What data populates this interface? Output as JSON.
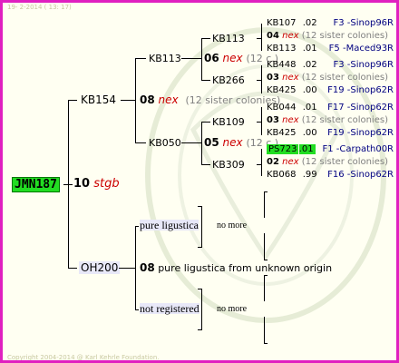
{
  "header": {
    "date": "19- 2-2014 ( 13: 17)"
  },
  "footer": {
    "copyright": "Copyright 2004-2014 @ Karl Kehrle Foundation."
  },
  "root": {
    "id": "JMN187"
  },
  "gen1": {
    "num": "10",
    "name": "stgb"
  },
  "sire": {
    "id": "KB154",
    "num": "08",
    "name": "nex",
    "note": "(12 sister colonies)"
  },
  "dam": {
    "id": "OH200",
    "num": "08",
    "desc": "pure ligustica from unknown origin"
  },
  "kb113": {
    "id": "KB113",
    "num": "06",
    "name": "nex",
    "note": "(12 c.)"
  },
  "kb050": {
    "id": "KB050",
    "num": "05",
    "name": "nex",
    "note": "(12 c.)"
  },
  "gp": [
    {
      "id": "KB113"
    },
    {
      "id": "KB266"
    },
    {
      "id": "KB109"
    },
    {
      "id": "KB309"
    }
  ],
  "dam_side": {
    "pure": "pure ligustica",
    "notreg": "not registered",
    "nomore1": "no more",
    "nomore2": "no more"
  },
  "leaves": [
    {
      "id": "KB107",
      "val": ".02",
      "origin": "F3 -Sinop96R"
    },
    {
      "num": "04",
      "name": "nex",
      "note": "(12 sister colonies)"
    },
    {
      "id": "KB113",
      "val": ".01",
      "origin": "F5 -Maced93R"
    },
    {
      "id": "KB448",
      "val": ".02",
      "origin": "F3 -Sinop96R"
    },
    {
      "num": "03",
      "name": "nex",
      "note": "(12 sister colonies)"
    },
    {
      "id": "KB425",
      "val": ".00",
      "origin": "F19 -Sinop62R"
    },
    {
      "id": "KB044",
      "val": ".01",
      "origin": "F17 -Sinop62R"
    },
    {
      "num": "03",
      "name": "nex",
      "note": "(12 sister colonies)"
    },
    {
      "id": "KB425",
      "val": ".00",
      "origin": "F19 -Sinop62R"
    },
    {
      "id": "PS723",
      "val": ".01",
      "origin": "F1 -Carpath00R"
    },
    {
      "num": "02",
      "name": "nex",
      "note": "(12 sister colonies)"
    },
    {
      "id": "KB068",
      "val": ".99",
      "origin": "F16 -Sinop62R"
    }
  ],
  "colors": {
    "border": "#e020c0",
    "root_bg": "#22dd22",
    "ps_bg": "#22dd22",
    "dam_bg": "#e8e8f8"
  }
}
